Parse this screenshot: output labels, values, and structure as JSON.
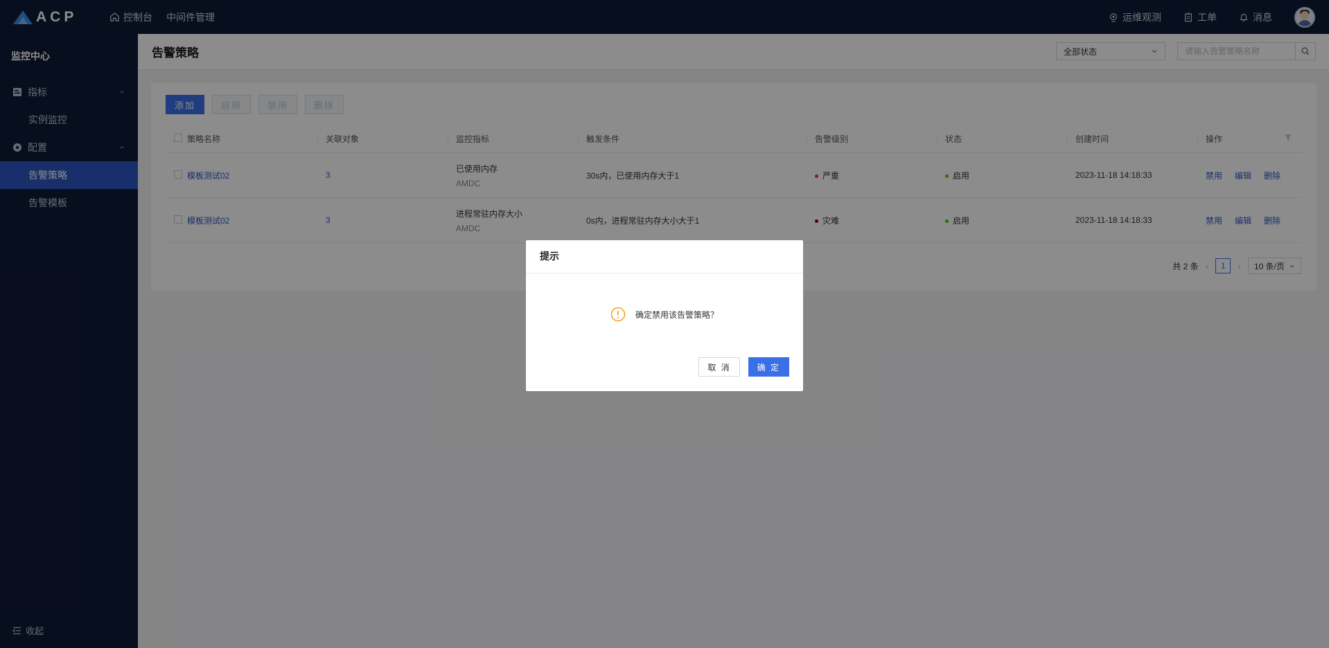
{
  "app": {
    "logo_text": "ACP"
  },
  "topnav": {
    "items": [
      {
        "label": "控制台"
      },
      {
        "label": "中间件管理"
      }
    ]
  },
  "topright": {
    "ops_label": "运维观测",
    "ticket_label": "工单",
    "message_label": "消息"
  },
  "sidebar": {
    "title": "监控中心",
    "group_metrics": "指标",
    "item_instance": "实例监控",
    "group_config": "配置",
    "item_policy": "告警策略",
    "item_template": "告警模板",
    "collapse": "收起"
  },
  "page": {
    "title": "告警策略",
    "status_select": "全部状态",
    "search_placeholder": "请输入告警策略名称"
  },
  "toolbar": {
    "add": "添加",
    "enable": "启用",
    "disable": "禁用",
    "delete": "删除"
  },
  "table": {
    "headers": [
      "策略名称",
      "关联对象",
      "监控指标",
      "触发条件",
      "告警级别",
      "状态",
      "创建时间",
      "操作"
    ],
    "rows": [
      {
        "name": "模板测试02",
        "objects": "3",
        "metric": "已使用内存",
        "metric_sub": "AMDC",
        "condition": "30s内，已使用内存大于1",
        "level": "严重",
        "level_color": "#d9363e",
        "status": "启用",
        "status_color": "#52c41a",
        "created": "2023-11-18 14:18:33",
        "act_disable": "禁用",
        "act_edit": "编辑",
        "act_delete": "删除"
      },
      {
        "name": "模板测试02",
        "objects": "3",
        "metric": "进程常驻内存大小",
        "metric_sub": "AMDC",
        "condition": "0s内，进程常驻内存大小大于1",
        "level": "灾难",
        "level_color": "#8b0000",
        "status": "启用",
        "status_color": "#52c41a",
        "created": "2023-11-18 14:18:33",
        "act_disable": "禁用",
        "act_edit": "编辑",
        "act_delete": "删除"
      }
    ]
  },
  "pager": {
    "total": "共 2 条",
    "page": "1",
    "size": "10 条/页"
  },
  "dialog": {
    "title": "提示",
    "message": "确定禁用该告警策略？",
    "cancel": "取 消",
    "ok": "确 定"
  },
  "colors": {
    "nav_bg": "#0e1a36",
    "accent": "#3a6fe8",
    "warning": "#f5a623"
  }
}
